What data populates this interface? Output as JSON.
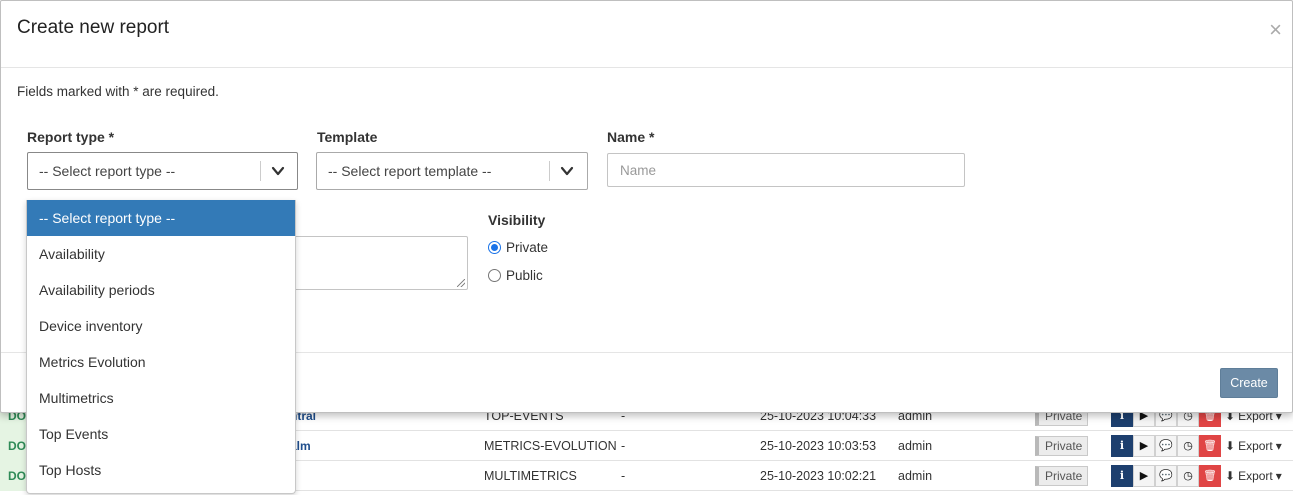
{
  "modal": {
    "title": "Create new report",
    "close_symbol": "×",
    "required_note": "Fields marked with * are required.",
    "report_type": {
      "label": "Report type *",
      "value": "-- Select report type --"
    },
    "template": {
      "label": "Template",
      "value": "-- Select report template --"
    },
    "name": {
      "label": "Name *",
      "placeholder": "Name",
      "value": ""
    },
    "visibility": {
      "label": "Visibility",
      "options": [
        {
          "label": "Private",
          "checked": true
        },
        {
          "label": "Public",
          "checked": false
        }
      ]
    },
    "create_label": "Create"
  },
  "dropdown": {
    "items": [
      "-- Select report type --",
      "Availability",
      "Availability periods",
      "Device inventory",
      "Metrics Evolution",
      "Multimetrics",
      "Top Events",
      "Top Hosts"
    ],
    "selected_index": 0
  },
  "background_rows": [
    {
      "status": "DO",
      "name": "ntral",
      "type": "TOP-EVENTS",
      "description": "-",
      "date": "25-10-2023 10:04:33",
      "owner": "admin",
      "visibility": "Private",
      "export": "Export"
    },
    {
      "status": "DO",
      "name": "alm",
      "type": "METRICS-EVOLUTION",
      "description": "-",
      "date": "25-10-2023 10:03:53",
      "owner": "admin",
      "visibility": "Private",
      "export": "Export"
    },
    {
      "status": "DO",
      "name": "",
      "type": "MULTIMETRICS",
      "description": "-",
      "date": "25-10-2023 10:02:21",
      "owner": "admin",
      "visibility": "Private",
      "export": "Export"
    }
  ],
  "colors": {
    "primary": "#337ab7",
    "create_button": "#6b8aa6",
    "delete": "#e04545",
    "info": "#1d3f6e"
  }
}
